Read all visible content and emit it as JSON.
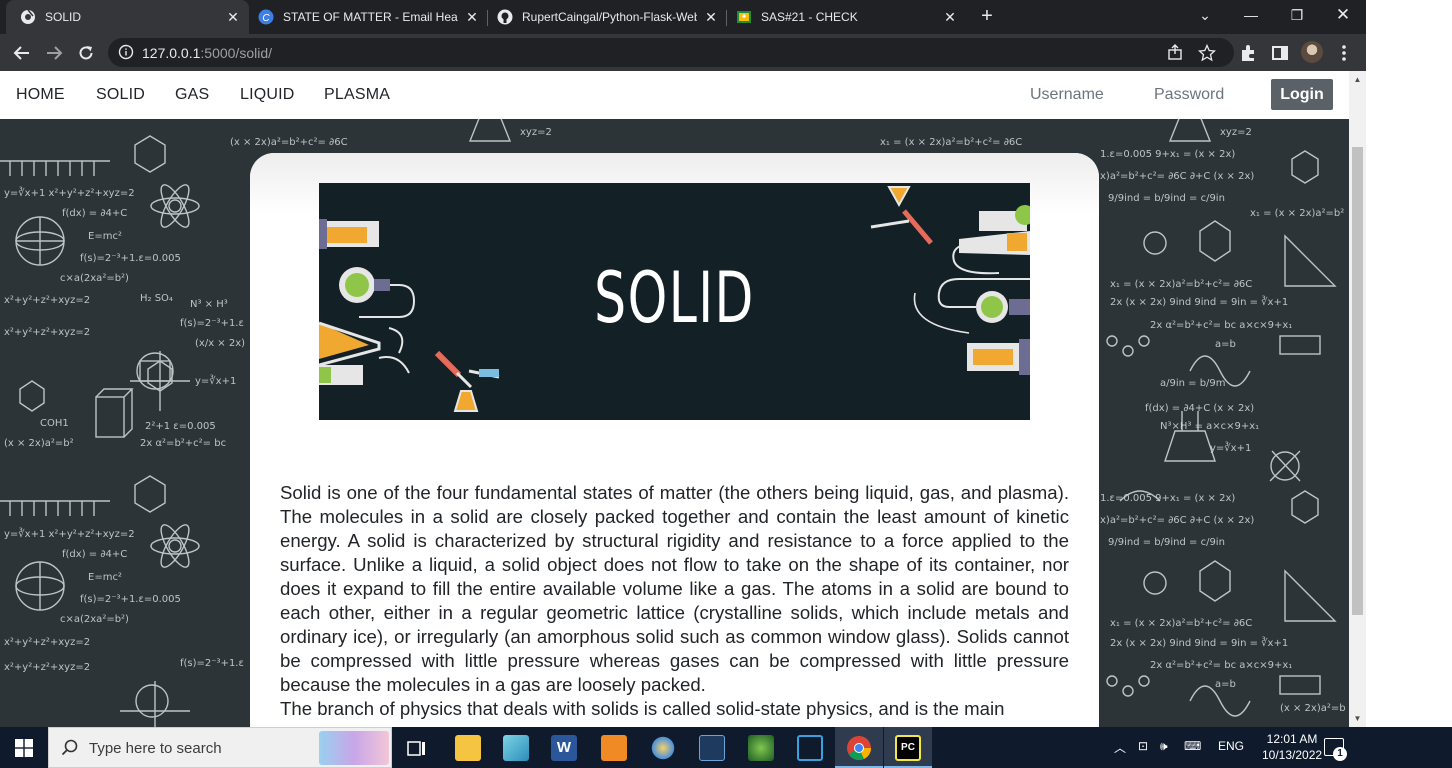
{
  "browser": {
    "tabs": [
      {
        "title": "SOLID",
        "active": true,
        "icon": "chrome-globe-icon"
      },
      {
        "title": "STATE OF MATTER - Email Header",
        "active": false,
        "icon": "canva-icon"
      },
      {
        "title": "RupertCaingal/Python-Flask-Web",
        "active": false,
        "icon": "github-icon"
      },
      {
        "title": "SAS#21 - CHECK",
        "active": false,
        "icon": "classroom-icon"
      }
    ],
    "url_host": "127.0.0.1",
    "url_rest": ":5000/solid/"
  },
  "site": {
    "nav": [
      "HOME",
      "SOLID",
      "GAS",
      "LIQUID",
      "PLASMA"
    ],
    "username_placeholder": "Username",
    "password_placeholder": "Password",
    "login_label": "Login",
    "banner_title": "SOLID",
    "paragraph_1": "Solid is one of the four fundamental states of matter (the others being liquid, gas, and plasma). The molecules in a solid are closely packed together and contain the least amount of kinetic energy. A solid is characterized by structural rigidity and resistance to a force applied to the surface. Unlike a liquid, a solid object does not flow to take on the shape of its container, nor does it expand to fill the entire available volume like a gas. The atoms in a solid are bound to each other, either in a regular geometric lattice (crystalline solids, which include metals and ordinary ice), or irregularly (an amorphous solid such as common window glass). Solids cannot be compressed with little pressure whereas gases can be compressed with little pressure because the molecules in a gas are loosely packed.",
    "paragraph_2": "The branch of physics that deals with solids is called solid-state physics, and is the main"
  },
  "taskbar": {
    "search_placeholder": "Type here to search",
    "language": "ENG",
    "time": "12:01 AM",
    "date": "10/13/2022",
    "notification_count": "1"
  },
  "colors": {
    "chalkboard": "#2c3438",
    "banner_bg": "#132126",
    "login_button": "#5a6268",
    "taskbar": "#0f1b2d"
  }
}
